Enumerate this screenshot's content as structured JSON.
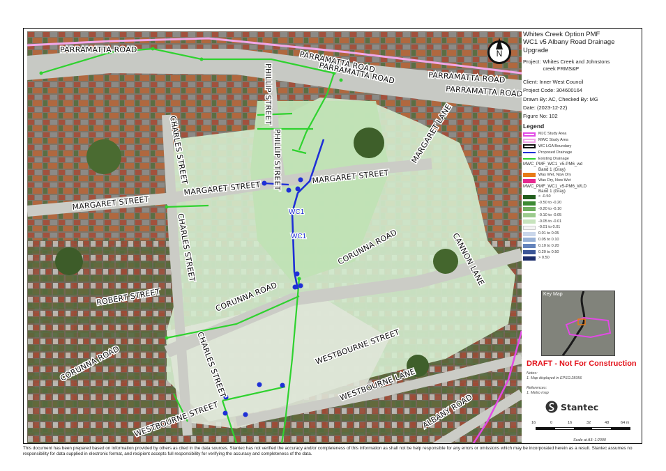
{
  "title": {
    "line1": "Whites Creek Option PMF",
    "line2": "WC1 v5 Albany Road Drainage",
    "line3": "Upgrade"
  },
  "project": {
    "label": "Project:",
    "value_line1": "Whites   Creek   and   Johnstons",
    "value_line2": "creek FRMS&P"
  },
  "meta": {
    "client": "Client:  Inner West Council",
    "project_code": "Project Code:  304600164",
    "drawn_by": "Drawn By:  AC, Checked By: MG",
    "date": "Date:   (2023-12-22)",
    "figure": "Figure No:   102"
  },
  "legend": {
    "title": "Legend",
    "boundaries": [
      {
        "label": "MJC Study Area",
        "color": "#e24ae5"
      },
      {
        "label": "MWC Study Area",
        "color": "#f2a7e9"
      },
      {
        "label": "WC LGA Boundary",
        "color": "#111111"
      }
    ],
    "lines": [
      {
        "label": "Proposed Drainage",
        "color": "#1e2fd6"
      },
      {
        "label": "Existing Drainage",
        "color": "#2fd22f"
      }
    ],
    "wd_head": "MWC_PMF_WC1_v5-PM6_wd",
    "wd_band": "Band 1 (Gray)",
    "wd_items": [
      {
        "label": "Was Wet, Now Dry",
        "color": "#e87b16"
      },
      {
        "label": "Was Dry, Now Wet",
        "color": "#e6288f"
      }
    ],
    "wld_head": "MWC_PMF_WC1_v5-PM6_WLD",
    "wld_band": "Band 1 (Gray)",
    "wld_items": [
      {
        "label": "< -0.50",
        "color": "#215d1c"
      },
      {
        "label": "-0.50 to -0.20",
        "color": "#3c8a33"
      },
      {
        "label": "-0.20 to -0.10",
        "color": "#6fae5f"
      },
      {
        "label": "-0.10 to -0.05",
        "color": "#9bcb8d"
      },
      {
        "label": "-0.05 to -0.01",
        "color": "#c7e3bd"
      },
      {
        "label": "-0.01 to 0.01",
        "color": "#f4f4f4"
      },
      {
        "label": "0.01 to 0.05",
        "color": "#c9d6ea"
      },
      {
        "label": "0.05 to 0.10",
        "color": "#99b1d6"
      },
      {
        "label": "0.10 to 0.20",
        "color": "#6483bb"
      },
      {
        "label": "0.20 to 0.50",
        "color": "#3a5597"
      },
      {
        "label": "> 0.50",
        "color": "#1b2c6a"
      }
    ]
  },
  "key_map": {
    "title": "Key Map"
  },
  "draft": "DRAFT - Not For Construction",
  "notes": {
    "heading": "Notes:",
    "item": "1. Map displayed in EPSG:28356"
  },
  "references": {
    "heading": "References:",
    "item": "1. Metro map"
  },
  "logo": {
    "name": "Stantec"
  },
  "scale": {
    "ticks": [
      "16",
      "0",
      "16",
      "32",
      "48",
      "64 m"
    ],
    "text": "Scale at A3: 1:2000"
  },
  "north_arrow": "N",
  "roads": [
    "PARRAMATTA ROAD",
    "PARRAMATTA ROAD",
    "PARRAMATTA ROAD",
    "PARRAMATTA ROAD",
    "PARRAMATTA ROAD",
    "PHILLIP STREET",
    "PHILLIP STREET",
    "CHARLES STREET",
    "CHARLES STREET",
    "CHARLES STREET",
    "MARGARET STREET",
    "MARGARET STREET",
    "MARGARET STREET",
    "MARGARET LANE",
    "CORUNNA ROAD",
    "CORUNNA ROAD",
    "CORUNNA ROAD",
    "CANNON LANE",
    "ROBERT STREET",
    "WESTBOURNE STREET",
    "WESTBOURNE STREET",
    "WESTBOURNE LANE",
    "ALBANY ROAD"
  ],
  "drainage_labels": [
    "WC1",
    "WC1"
  ],
  "disclaimer": "This document has been prepared based on information provided by others as cited in the data sources. Stantec has not verified the accuracy and/or completeness of this information as shall not be help responsible for any errors or omissions which may be incorporated herein as a result. Stantec assumes no responsibility for data supplied in electronic format, and recipient accepts full responsibility for verifying the accuracy and completeness of the data."
}
